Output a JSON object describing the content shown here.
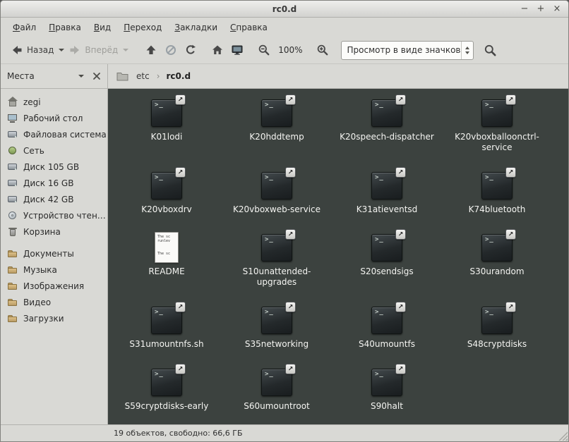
{
  "window": {
    "title": "rc0.d",
    "controls": [
      {
        "id": "minimize",
        "glyph": "−"
      },
      {
        "id": "maximize",
        "glyph": "+"
      },
      {
        "id": "close",
        "glyph": "×"
      }
    ]
  },
  "menubar": {
    "items": [
      {
        "label": "Файл"
      },
      {
        "label": "Правка"
      },
      {
        "label": "Вид"
      },
      {
        "label": "Переход"
      },
      {
        "label": "Закладки"
      },
      {
        "label": "Справка"
      }
    ]
  },
  "toolbar": {
    "back": "Назад",
    "forward": "Вперёд",
    "zoom_level": "100%",
    "view_mode": "Просмотр в виде значков"
  },
  "pathbar": {
    "segments": [
      {
        "label": "etc"
      },
      {
        "label": "rc0.d"
      }
    ]
  },
  "sidebar": {
    "title": "Места",
    "items": [
      {
        "label": "zegi",
        "icon": "home"
      },
      {
        "label": "Рабочий стол",
        "icon": "desktop"
      },
      {
        "label": "Файловая система",
        "icon": "filesystem"
      },
      {
        "label": "Сеть",
        "icon": "network"
      },
      {
        "label": "Диск 105 GB",
        "icon": "drive"
      },
      {
        "label": "Диск 16 GB",
        "icon": "drive"
      },
      {
        "label": "Диск 42 GB",
        "icon": "drive"
      },
      {
        "label": "Устройство чтен…",
        "icon": "optical"
      },
      {
        "label": "Корзина",
        "icon": "trash"
      },
      {
        "label": "Документы",
        "icon": "folder",
        "gap": true
      },
      {
        "label": "Музыка",
        "icon": "folder"
      },
      {
        "label": "Изображения",
        "icon": "folder"
      },
      {
        "label": "Видео",
        "icon": "folder"
      },
      {
        "label": "Загрузки",
        "icon": "folder"
      }
    ]
  },
  "files": [
    {
      "name": "K01lodi",
      "icon": "terminal",
      "symlink": true
    },
    {
      "name": "K20hddtemp",
      "icon": "terminal",
      "symlink": true
    },
    {
      "name": "K20speech-dispatcher",
      "icon": "terminal",
      "symlink": true
    },
    {
      "name": "K20vboxballoonctrl-service",
      "icon": "terminal",
      "symlink": true
    },
    {
      "name": "K20vboxdrv",
      "icon": "terminal",
      "symlink": true
    },
    {
      "name": "K20vboxweb-service",
      "icon": "terminal",
      "symlink": true
    },
    {
      "name": "K31atieventsd",
      "icon": "terminal",
      "symlink": true
    },
    {
      "name": "K74bluetooth",
      "icon": "terminal",
      "symlink": true
    },
    {
      "name": "README",
      "icon": "text",
      "symlink": false,
      "preview": "The sc\nrunlev\n\n\nThe sc"
    },
    {
      "name": "S10unattended-upgrades",
      "icon": "terminal",
      "symlink": true
    },
    {
      "name": "S20sendsigs",
      "icon": "terminal",
      "symlink": true
    },
    {
      "name": "S30urandom",
      "icon": "terminal",
      "symlink": true
    },
    {
      "name": "S31umountnfs.sh",
      "icon": "terminal",
      "symlink": true
    },
    {
      "name": "S35networking",
      "icon": "terminal",
      "symlink": true
    },
    {
      "name": "S40umountfs",
      "icon": "terminal",
      "symlink": true
    },
    {
      "name": "S48cryptdisks",
      "icon": "terminal",
      "symlink": true
    },
    {
      "name": "S59cryptdisks-early",
      "icon": "terminal",
      "symlink": true
    },
    {
      "name": "S60umountroot",
      "icon": "terminal",
      "symlink": true
    },
    {
      "name": "S90halt",
      "icon": "terminal",
      "symlink": true
    }
  ],
  "statusbar": {
    "text": "19 объектов, свободно: 66,6 ГБ"
  },
  "colors": {
    "chrome_bg": "#d9d9d5",
    "content_bg": "#3c423f",
    "file_label": "#f4f4f1"
  }
}
